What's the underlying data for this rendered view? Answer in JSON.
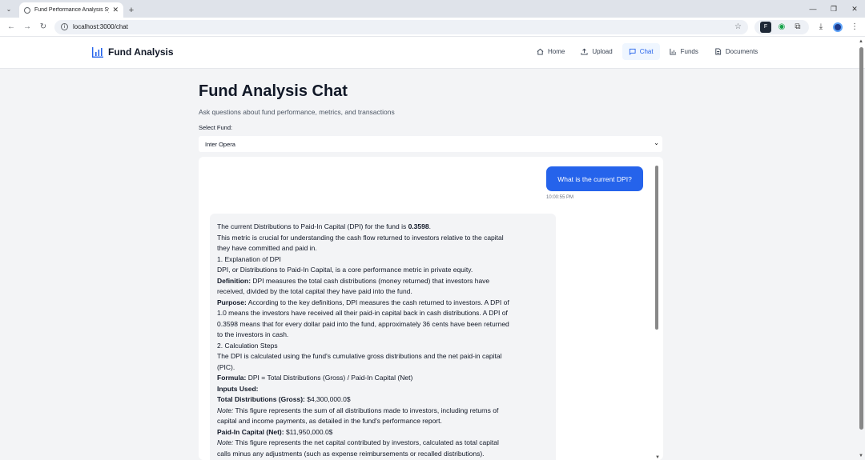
{
  "browser": {
    "tab_title": "Fund Performance Analysis Sys",
    "url": "localhost:3000/chat"
  },
  "header": {
    "brand": "Fund Analysis",
    "nav": [
      {
        "label": "Home",
        "icon": "home-icon"
      },
      {
        "label": "Upload",
        "icon": "upload-icon"
      },
      {
        "label": "Chat",
        "icon": "chat-icon",
        "active": true
      },
      {
        "label": "Funds",
        "icon": "bar-chart-icon"
      },
      {
        "label": "Documents",
        "icon": "document-icon"
      }
    ]
  },
  "page": {
    "title": "Fund Analysis Chat",
    "subtitle": "Ask questions about fund performance, metrics, and transactions",
    "select_label": "Select Fund:",
    "selected_fund": "Inter Opera"
  },
  "chat": {
    "user_message": "What is the current DPI?",
    "user_time": "10:00:55 PM",
    "response": {
      "l1_pre": "The current Distributions to Paid-In Capital (DPI) for the fund is ",
      "l1_bold": "0.3598",
      "l1_post": ".",
      "l2": "This metric is crucial for understanding the cash flow returned to investors relative to the capital",
      "l3": "they have committed and paid in.",
      "l4": "1. Explanation of DPI",
      "l5": "DPI, or Distributions to Paid-In Capital, is a core performance metric in private equity.",
      "l6_bold": "Definition:",
      "l6": " DPI measures the total cash distributions (money returned) that investors have",
      "l7": "received, divided by the total capital they have paid into the fund.",
      "l8_bold": "Purpose:",
      "l8": " According to the key definitions, DPI measures the cash returned to investors. A DPI of",
      "l9": "1.0 means the investors have received all their paid-in capital back in cash distributions. A DPI of",
      "l10": "0.3598 means that for every dollar paid into the fund, approximately 36 cents have been returned",
      "l11": "to the investors in cash.",
      "l12": "2. Calculation Steps",
      "l13": "The DPI is calculated using the fund's cumulative gross distributions and the net paid-in capital",
      "l14": "(PIC).",
      "l15_bold": "Formula:",
      "l15": " DPI = Total Distributions (Gross) / Paid-In Capital (Net)",
      "l16_bold": "Inputs Used:",
      "l17_bold": "Total Distributions (Gross):",
      "l17": " $4,300,000.0$",
      "l18_italic": "Note:",
      "l18": " This figure represents the sum of all distributions made to investors, including returns of",
      "l19": "capital and income payments, as detailed in the fund's performance report.",
      "l20_bold": "Paid-In Capital (Net):",
      "l20": " $11,950,000.0$",
      "l21_italic": "Note:",
      "l21": " This figure represents the net capital contributed by investors, calculated as total capital",
      "l22": "calls minus any adjustments (such as expense reimbursements or recalled distributions)."
    }
  }
}
